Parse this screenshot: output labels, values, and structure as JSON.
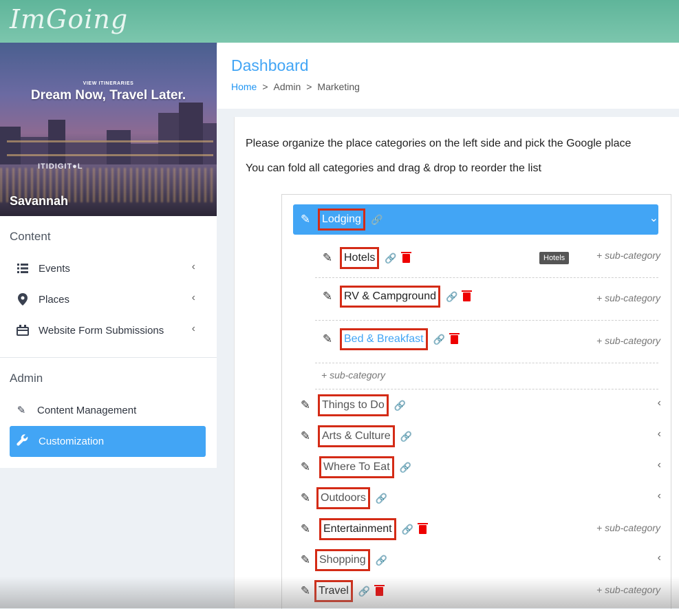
{
  "app": {
    "logo_text": "ImGoing"
  },
  "sidebar": {
    "hero": {
      "view_label": "VIEW ITINERARIES",
      "headline": "Dream Now, Travel Later.",
      "brand": "ITIDIGIT●L",
      "city": "Savannah"
    },
    "content_title": "Content",
    "content_items": [
      {
        "label": "Events",
        "icon": "list-icon"
      },
      {
        "label": "Places",
        "icon": "map-pin-icon"
      },
      {
        "label": "Website Form Submissions",
        "icon": "form-icon"
      }
    ],
    "admin_title": "Admin",
    "admin_items": [
      {
        "label": "Content Management",
        "icon": "pencil-icon"
      },
      {
        "label": "Customization",
        "icon": "wrench-icon",
        "active": true
      }
    ]
  },
  "header": {
    "title": "Dashboard",
    "breadcrumb": [
      "Home",
      ">",
      "Admin",
      ">",
      "Marketing"
    ]
  },
  "main": {
    "intro_line1": "Please organize the place categories on the left side and pick the Google place",
    "intro_line2": "You can fold all categories and drag & drop to reorder the list",
    "sub_category_label": "+ sub-category",
    "tooltip": "Hotels",
    "categories": [
      {
        "label": "Lodging",
        "expanded": true,
        "children": [
          {
            "label": "Hotels"
          },
          {
            "label": "RV & Campground"
          },
          {
            "label": "Bed & Breakfast",
            "highlight": true
          }
        ]
      },
      {
        "label": "Things to Do",
        "collapsed": true
      },
      {
        "label": "Arts & Culture",
        "collapsed": true
      },
      {
        "label": "Where To Eat",
        "collapsed": true
      },
      {
        "label": "Outdoors",
        "collapsed": true
      },
      {
        "label": "Entertainment"
      },
      {
        "label": "Shopping",
        "collapsed": true
      },
      {
        "label": "Travel"
      }
    ]
  },
  "colors": {
    "accent": "#42a5f5",
    "topbar": "#6bbda3",
    "highlight_box": "#d42b16",
    "delete": "#e00000"
  }
}
